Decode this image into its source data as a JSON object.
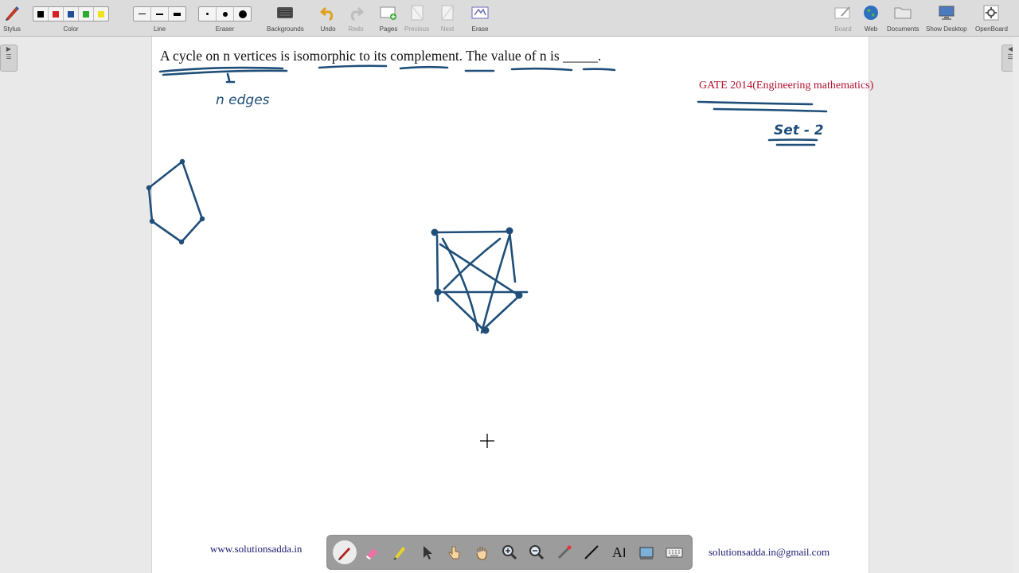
{
  "toolbar": {
    "stylus": "Stylus",
    "color": "Color",
    "line": "Line",
    "eraser": "Eraser",
    "backgrounds": "Backgrounds",
    "undo": "Undo",
    "redo": "Redo",
    "pages": "Pages",
    "previous": "Previous",
    "next": "Next",
    "erase": "Erase",
    "board": "Board",
    "web": "Web",
    "documents": "Documents",
    "show_desktop": "Show Desktop",
    "openboard": "OpenBoard",
    "colors": [
      "#000000",
      "#d81f26",
      "#1f4f99",
      "#2eaa2e",
      "#f2e21a"
    ]
  },
  "board": {
    "question": "A cycle on n vertices is isomorphic to its complement. The value of n is _____.",
    "source": "GATE 2014(Engineering mathematics)",
    "handwriting_edges": "n edges",
    "handwriting_set": "Set - 2",
    "ink_color": "#1f4f79"
  },
  "footer": {
    "website": "www.solutionsadda.in",
    "email": "solutionsadda.in@gmail.com"
  },
  "dock": {
    "text_tool_label": "A"
  }
}
